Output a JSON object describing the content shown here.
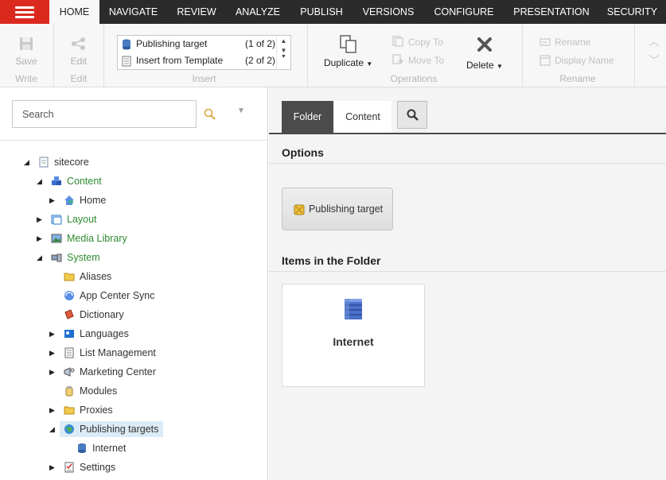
{
  "nav": {
    "tabs": [
      {
        "label": "HOME",
        "active": true
      },
      {
        "label": "NAVIGATE"
      },
      {
        "label": "REVIEW"
      },
      {
        "label": "ANALYZE"
      },
      {
        "label": "PUBLISH"
      },
      {
        "label": "VERSIONS"
      },
      {
        "label": "CONFIGURE"
      },
      {
        "label": "PRESENTATION"
      },
      {
        "label": "SECURITY"
      }
    ]
  },
  "ribbon": {
    "write": {
      "save": "Save",
      "group": "Write"
    },
    "edit": {
      "edit": "Edit",
      "group": "Edit"
    },
    "insert": {
      "items": [
        {
          "label": "Publishing target",
          "count": "(1 of 2)"
        },
        {
          "label": "Insert from Template",
          "count": "(2 of 2)"
        }
      ],
      "group": "Insert"
    },
    "operations": {
      "duplicate": "Duplicate",
      "copy_to": "Copy To",
      "move_to": "Move To",
      "delete": "Delete",
      "group": "Operations"
    },
    "rename": {
      "rename": "Rename",
      "display_name": "Display Name",
      "group": "Rename"
    }
  },
  "search": {
    "placeholder": "Search"
  },
  "tree": [
    {
      "label": "sitecore",
      "expanded": true
    },
    {
      "label": "Content",
      "expanded": true
    },
    {
      "label": "Home"
    },
    {
      "label": "Layout"
    },
    {
      "label": "Media Library"
    },
    {
      "label": "System",
      "expanded": true
    },
    {
      "label": "Aliases"
    },
    {
      "label": "App Center Sync"
    },
    {
      "label": "Dictionary"
    },
    {
      "label": "Languages"
    },
    {
      "label": "List Management"
    },
    {
      "label": "Marketing Center"
    },
    {
      "label": "Modules"
    },
    {
      "label": "Proxies"
    },
    {
      "label": "Publishing targets",
      "expanded": true,
      "selected": true
    },
    {
      "label": "Internet"
    },
    {
      "label": "Settings"
    }
  ],
  "editor": {
    "tabs": {
      "folder": "Folder",
      "content": "Content"
    },
    "options_title": "Options",
    "option_button": "Publishing target",
    "items_title": "Items in the Folder",
    "items": [
      {
        "label": "Internet"
      }
    ]
  },
  "colors": {
    "brand": "#dc291e",
    "nav_bg": "#2b2b2b",
    "tree_green": "#2e8b30",
    "selection": "#dcebf5"
  }
}
